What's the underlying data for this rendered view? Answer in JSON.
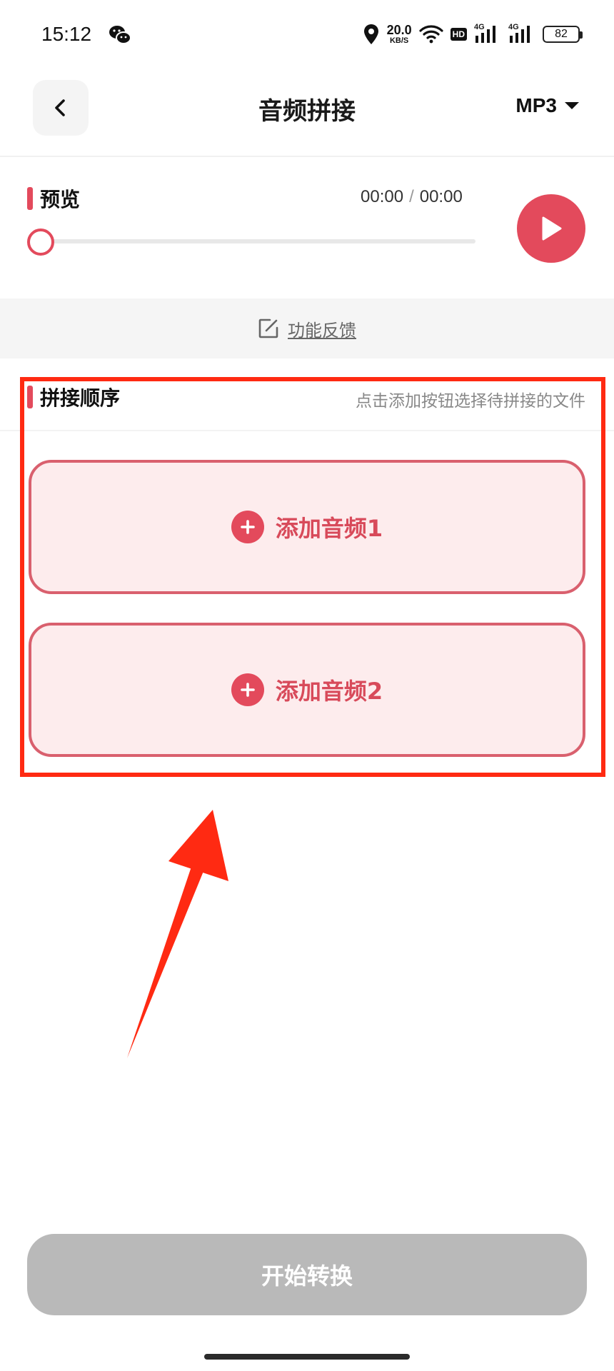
{
  "status_bar": {
    "time": "15:12",
    "network_speed_value": "20.0",
    "network_speed_unit": "KB/S",
    "hd_badge": "HD",
    "signal_1_label": "4G",
    "signal_2_label": "4G",
    "battery_level": "82",
    "icons": [
      "wechat-icon",
      "location-icon",
      "wifi-icon",
      "signal-icon",
      "signal-icon",
      "battery-icon"
    ]
  },
  "header": {
    "title": "音频拼接",
    "format_selected": "MP3"
  },
  "preview": {
    "label": "预览",
    "current_time": "00:00",
    "separator": "/",
    "total_time": "00:00",
    "progress": 0
  },
  "feedback": {
    "label": "功能反馈"
  },
  "order": {
    "title": "拼接顺序",
    "hint": "点击添加按钮选择待拼接的文件",
    "add_buttons": [
      {
        "label": "添加音频1"
      },
      {
        "label": "添加音频2"
      }
    ]
  },
  "actions": {
    "start_label": "开始转换"
  },
  "colors": {
    "accent": "#e34a5c",
    "card_fill": "#fdeced",
    "annotation": "#ff2a12",
    "disabled_button": "#b9b9b9"
  }
}
